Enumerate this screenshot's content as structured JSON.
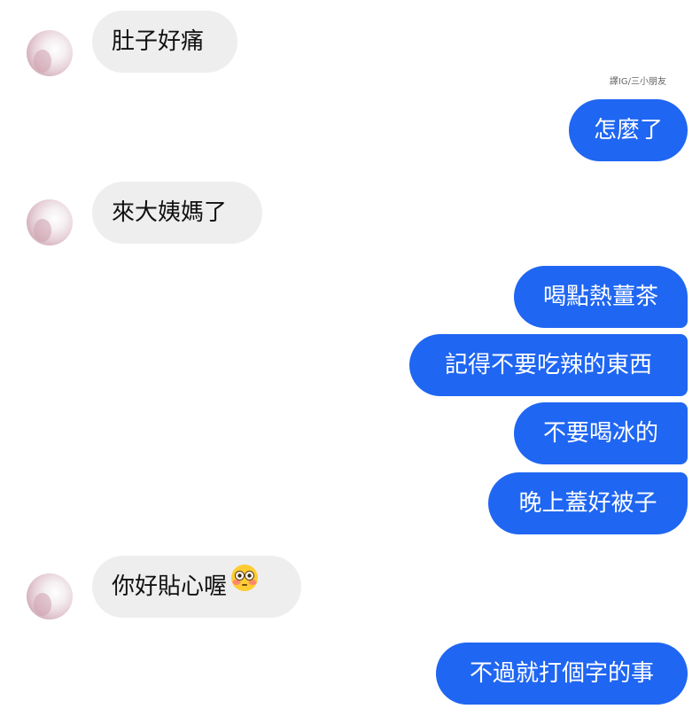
{
  "chat": {
    "watermark": "譯IG/三小朋友",
    "messages": [
      {
        "side": "incoming",
        "text": "肚子好痛"
      },
      {
        "side": "outgoing",
        "text": "怎麼了"
      },
      {
        "side": "incoming",
        "text": "來大姨媽了"
      },
      {
        "side": "outgoing",
        "text": "喝點熱薑茶"
      },
      {
        "side": "outgoing",
        "text": "記得不要吃辣的東西"
      },
      {
        "side": "outgoing",
        "text": "不要喝冰的"
      },
      {
        "side": "outgoing",
        "text": "晚上蓋好被子"
      },
      {
        "side": "incoming",
        "text": "你好貼心喔",
        "emoji": "flushed-face-emoji"
      },
      {
        "side": "outgoing",
        "text": "不過就打個字的事"
      }
    ]
  },
  "colors": {
    "outgoing_bubble": "#1f66f2",
    "incoming_bubble": "#eeeeee",
    "background": "#ffffff"
  }
}
